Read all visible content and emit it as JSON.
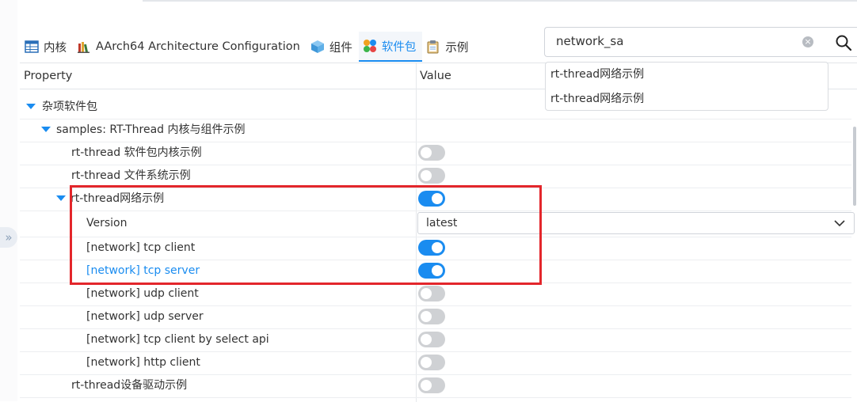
{
  "tabs": [
    {
      "label": "内核",
      "icon": "table-icon"
    },
    {
      "label": "AArch64 Architecture Configuration",
      "icon": "books-icon"
    },
    {
      "label": "组件",
      "icon": "cube-icon"
    },
    {
      "label": "软件包",
      "icon": "packages-icon",
      "active": true
    },
    {
      "label": "示例",
      "icon": "clipboard-icon"
    }
  ],
  "search": {
    "value": "network_sa"
  },
  "suggestions": [
    "rt-thread网络示例",
    "rt-thread网络示例"
  ],
  "columns": {
    "property": "Property",
    "value": "Value"
  },
  "rows": [
    {
      "label": "杂项软件包",
      "expanded": true
    },
    {
      "label": "samples: RT-Thread 内核与组件示例",
      "expanded": true
    },
    {
      "label": "rt-thread 软件包内核示例",
      "toggle": false
    },
    {
      "label": "rt-thread 文件系统示例",
      "toggle": false
    },
    {
      "label": "rt-thread网络示例",
      "expanded": true,
      "toggle": true
    },
    {
      "label": "Version",
      "select": "latest"
    },
    {
      "label": "[network] tcp client",
      "toggle": true
    },
    {
      "label": "[network] tcp server",
      "toggle": true,
      "highlight": true
    },
    {
      "label": "[network] udp client",
      "toggle": false
    },
    {
      "label": "[network] udp server",
      "toggle": false
    },
    {
      "label": "[network] tcp client by select api",
      "toggle": false
    },
    {
      "label": "[network] http client",
      "toggle": false
    },
    {
      "label": "rt-thread设备驱动示例",
      "toggle": false
    }
  ],
  "colors": {
    "accent": "#1a8cf0",
    "highlight_box": "#e3262b",
    "toggle_off": "#cfd1d4"
  }
}
